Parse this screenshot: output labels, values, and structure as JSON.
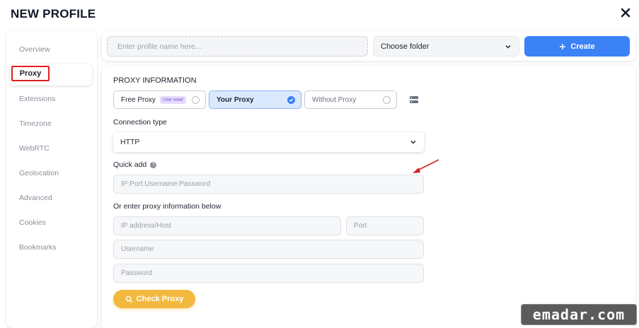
{
  "header": {
    "title": "NEW PROFILE"
  },
  "sidebar": {
    "items": [
      {
        "label": "Overview"
      },
      {
        "label": "Proxy"
      },
      {
        "label": "Extensions"
      },
      {
        "label": "Timezone"
      },
      {
        "label": "WebRTC"
      },
      {
        "label": "Geolocation"
      },
      {
        "label": "Advanced"
      },
      {
        "label": "Cookies"
      },
      {
        "label": "Bookmarks"
      }
    ]
  },
  "topbar": {
    "profile_name_placeholder": "Enter profile name here...",
    "folder_value": "Choose folder",
    "create_label": "Create"
  },
  "proxy": {
    "section_title": "PROXY INFORMATION",
    "options": {
      "free": "Free Proxy",
      "free_badge": "Use now!",
      "your": "Your Proxy",
      "without": "Without Proxy"
    },
    "connection_type_label": "Connection type",
    "connection_type_value": "HTTP",
    "quick_add_label": "Quick add",
    "quick_add_placeholder": "IP:Port:Username:Password",
    "or_enter_label": "Or enter proxy information below",
    "ip_placeholder": "IP address/Host",
    "port_placeholder": "Port",
    "username_placeholder": "Username",
    "password_placeholder": "Password",
    "check_label": "Check Proxy"
  },
  "watermark": "emadar.com",
  "colors": {
    "accent": "#3b82f6",
    "check": "#f3b93f",
    "highlight": "#e02020"
  }
}
